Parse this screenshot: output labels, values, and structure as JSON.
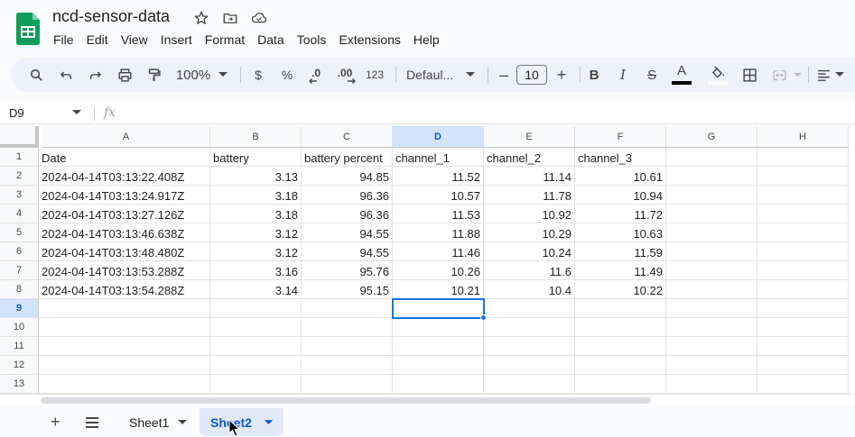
{
  "app": {
    "title": "ncd-sensor-data"
  },
  "menu": [
    "File",
    "Edit",
    "View",
    "Insert",
    "Format",
    "Data",
    "Tools",
    "Extensions",
    "Help"
  ],
  "toolbar": {
    "zoom": "100%",
    "currency": "$",
    "percent": "%",
    "decrease_decimal": ".0",
    "increase_decimal": ".00",
    "number_format": "123",
    "font_name": "Defaul...",
    "font_size": "10",
    "minus": "–",
    "plus": "+",
    "bold": "B",
    "italic": "I",
    "strike": "S",
    "text_color_letter": "A",
    "text_color": "#000000"
  },
  "formula_bar": {
    "name_box": "D9",
    "fx": "fx",
    "content": ""
  },
  "grid": {
    "columns": [
      "A",
      "B",
      "C",
      "D",
      "E",
      "F",
      "G",
      "H"
    ],
    "selected_column": "D",
    "rows": [
      "1",
      "2",
      "3",
      "4",
      "5",
      "6",
      "7",
      "8",
      "9",
      "10",
      "11",
      "12",
      "13"
    ],
    "selected_row": "9",
    "header": [
      "Date",
      "battery",
      "battery percent",
      "channel_1",
      "channel_2",
      "channel_3"
    ],
    "data": [
      [
        "2024-04-14T03:13:22.408Z",
        "3.13",
        "94.85",
        "11.52",
        "11.14",
        "10.61"
      ],
      [
        "2024-04-14T03:13:24.917Z",
        "3.18",
        "96.36",
        "10.57",
        "11.78",
        "10.94"
      ],
      [
        "2024-04-14T03:13:27.126Z",
        "3.18",
        "96.36",
        "11.53",
        "10.92",
        "11.72"
      ],
      [
        "2024-04-14T03:13:46.638Z",
        "3.12",
        "94.55",
        "11.88",
        "10.29",
        "10.63"
      ],
      [
        "2024-04-14T03:13:48.480Z",
        "3.12",
        "94.55",
        "11.46",
        "10.24",
        "11.59"
      ],
      [
        "2024-04-14T03:13:53.288Z",
        "3.16",
        "95.76",
        "10.26",
        "11.6",
        "11.49"
      ],
      [
        "2024-04-14T03:13:54.288Z",
        "3.14",
        "95.15",
        "10.21",
        "10.4",
        "10.22"
      ]
    ]
  },
  "sheets": {
    "add": "+",
    "tabs": [
      {
        "label": "Sheet1",
        "active": false
      },
      {
        "label": "Sheet2",
        "active": true
      }
    ]
  },
  "colors": {
    "accent": "#1a73e8",
    "brand_green": "#0f9d58",
    "active_tab": "#0b57d0"
  }
}
